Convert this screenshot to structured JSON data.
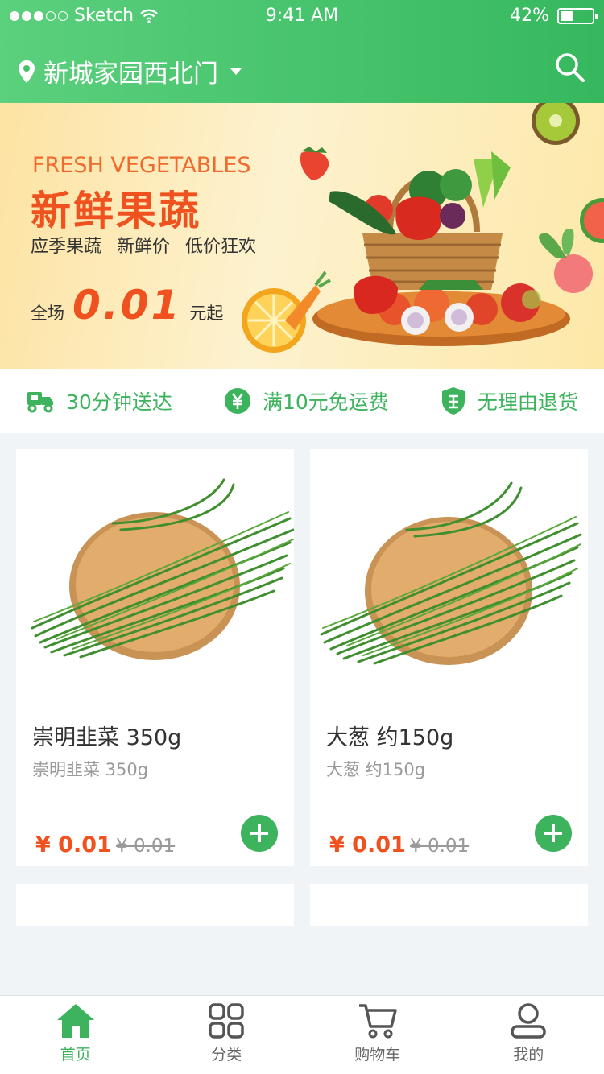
{
  "status": {
    "carrier": "Sketch",
    "time": "9:41 AM",
    "battery": "42%",
    "battery_level": 0.42
  },
  "header": {
    "location": "新城家园西北门"
  },
  "banner": {
    "title_en": "FRESH VEGETABLES",
    "title_cn": "新鲜果蔬",
    "subtitle": "应季果蔬 新鲜价 低价狂欢",
    "price_prefix": "全场",
    "price_value": "0.01",
    "price_suffix": "元起"
  },
  "features": [
    {
      "icon": "truck-icon",
      "label": "30分钟送达"
    },
    {
      "icon": "yen-icon",
      "label": "满10元免运费"
    },
    {
      "icon": "return-shield-icon",
      "label": "无理由退货"
    }
  ],
  "products": [
    {
      "name": "崇明韭菜 350g",
      "desc": "崇明韭菜 350g",
      "price": "¥ 0.01",
      "old_price": "¥ 0.01"
    },
    {
      "name": "大葱 约150g",
      "desc": "大葱 约150g",
      "price": "¥ 0.01",
      "old_price": "¥ 0.01"
    }
  ],
  "tabs": [
    {
      "icon": "home-icon",
      "label": "首页",
      "active": true
    },
    {
      "icon": "category-grid-icon",
      "label": "分类",
      "active": false
    },
    {
      "icon": "cart-icon",
      "label": "购物车",
      "active": false
    },
    {
      "icon": "user-icon",
      "label": "我的",
      "active": false
    }
  ],
  "colors": {
    "brand_green": "#3cb35c",
    "price_orange": "#f0521f"
  }
}
